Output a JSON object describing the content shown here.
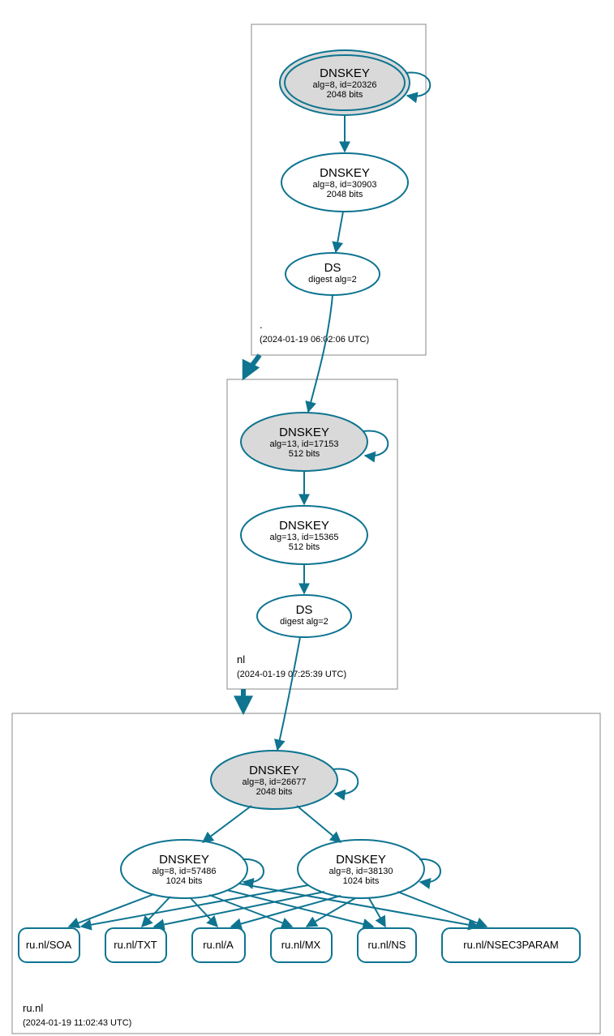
{
  "zones": {
    "root": {
      "label": ".",
      "timestamp": "(2024-01-19 06:02:06 UTC)"
    },
    "nl": {
      "label": "nl",
      "timestamp": "(2024-01-19 07:25:39 UTC)"
    },
    "runl": {
      "label": "ru.nl",
      "timestamp": "(2024-01-19 11:02:43 UTC)"
    }
  },
  "nodes": {
    "root_ksk": {
      "title": "DNSKEY",
      "line1": "alg=8, id=20326",
      "line2": "2048 bits"
    },
    "root_zsk": {
      "title": "DNSKEY",
      "line1": "alg=8, id=30903",
      "line2": "2048 bits"
    },
    "root_ds": {
      "title": "DS",
      "line1": "digest alg=2"
    },
    "nl_ksk": {
      "title": "DNSKEY",
      "line1": "alg=13, id=17153",
      "line2": "512 bits"
    },
    "nl_zsk": {
      "title": "DNSKEY",
      "line1": "alg=13, id=15365",
      "line2": "512 bits"
    },
    "nl_ds": {
      "title": "DS",
      "line1": "digest alg=2"
    },
    "runl_ksk": {
      "title": "DNSKEY",
      "line1": "alg=8, id=26677",
      "line2": "2048 bits"
    },
    "runl_zsk1": {
      "title": "DNSKEY",
      "line1": "alg=8, id=57486",
      "line2": "1024 bits"
    },
    "runl_zsk2": {
      "title": "DNSKEY",
      "line1": "alg=8, id=38130",
      "line2": "1024 bits"
    }
  },
  "rrsets": {
    "soa": "ru.nl/SOA",
    "txt": "ru.nl/TXT",
    "a": "ru.nl/A",
    "mx": "ru.nl/MX",
    "ns": "ru.nl/NS",
    "n3p": "ru.nl/NSEC3PARAM"
  }
}
